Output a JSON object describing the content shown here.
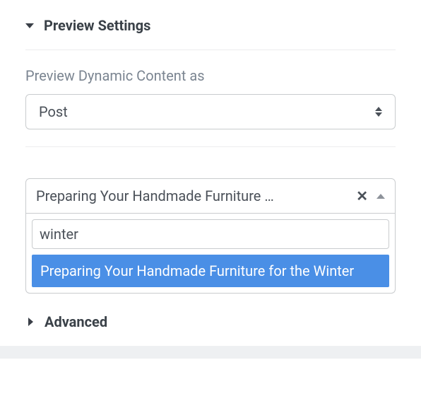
{
  "section": {
    "title": "Preview Settings"
  },
  "preview_field": {
    "label": "Preview Dynamic Content as",
    "value": "Post"
  },
  "combo": {
    "selected_display": "Preparing Your Handmade Furniture …",
    "search_value": "winter",
    "option": "Preparing Your Handmade Furniture for the Winter"
  },
  "advanced": {
    "title": "Advanced"
  }
}
